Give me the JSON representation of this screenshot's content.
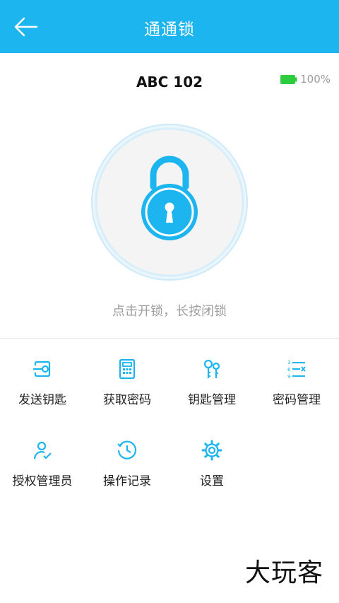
{
  "header": {
    "title": "通通锁"
  },
  "device": {
    "name": "ABC 102",
    "battery": "100%"
  },
  "lock": {
    "hint": "点击开锁，长按闭锁"
  },
  "menu": [
    {
      "label": "发送钥匙",
      "icon": "send-key-icon"
    },
    {
      "label": "获取密码",
      "icon": "calculator-icon"
    },
    {
      "label": "钥匙管理",
      "icon": "keys-icon"
    },
    {
      "label": "密码管理",
      "icon": "number-list-icon"
    },
    {
      "label": "授权管理员",
      "icon": "user-check-icon"
    },
    {
      "label": "操作记录",
      "icon": "history-icon"
    },
    {
      "label": "设置",
      "icon": "gear-icon"
    }
  ],
  "watermark": "大玩客",
  "colors": {
    "primary": "#1cb5f0",
    "battery": "#2ecc40"
  }
}
